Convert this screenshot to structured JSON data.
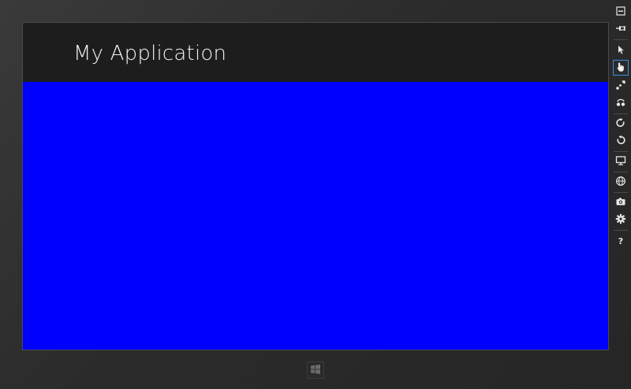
{
  "app": {
    "title": "My Application",
    "header_color": "#1d1d1d",
    "body_color": "#0000ff"
  },
  "simulator_toolbar": {
    "items": [
      {
        "icon": "minimize-icon"
      },
      {
        "icon": "pin-icon"
      },
      {
        "icon": "mouse-mode-icon"
      },
      {
        "icon": "touch-mode-icon",
        "active": true
      },
      {
        "icon": "pinch-zoom-icon"
      },
      {
        "icon": "rotation-touch-icon"
      },
      {
        "icon": "rotate-clockwise-icon"
      },
      {
        "icon": "rotate-counterclockwise-icon"
      },
      {
        "icon": "change-resolution-icon"
      },
      {
        "icon": "set-location-icon"
      },
      {
        "icon": "screenshot-icon"
      },
      {
        "icon": "settings-icon"
      },
      {
        "icon": "help-icon"
      }
    ],
    "help_label": "?"
  },
  "bezel": {
    "start_button_icon": "windows-logo-icon"
  }
}
